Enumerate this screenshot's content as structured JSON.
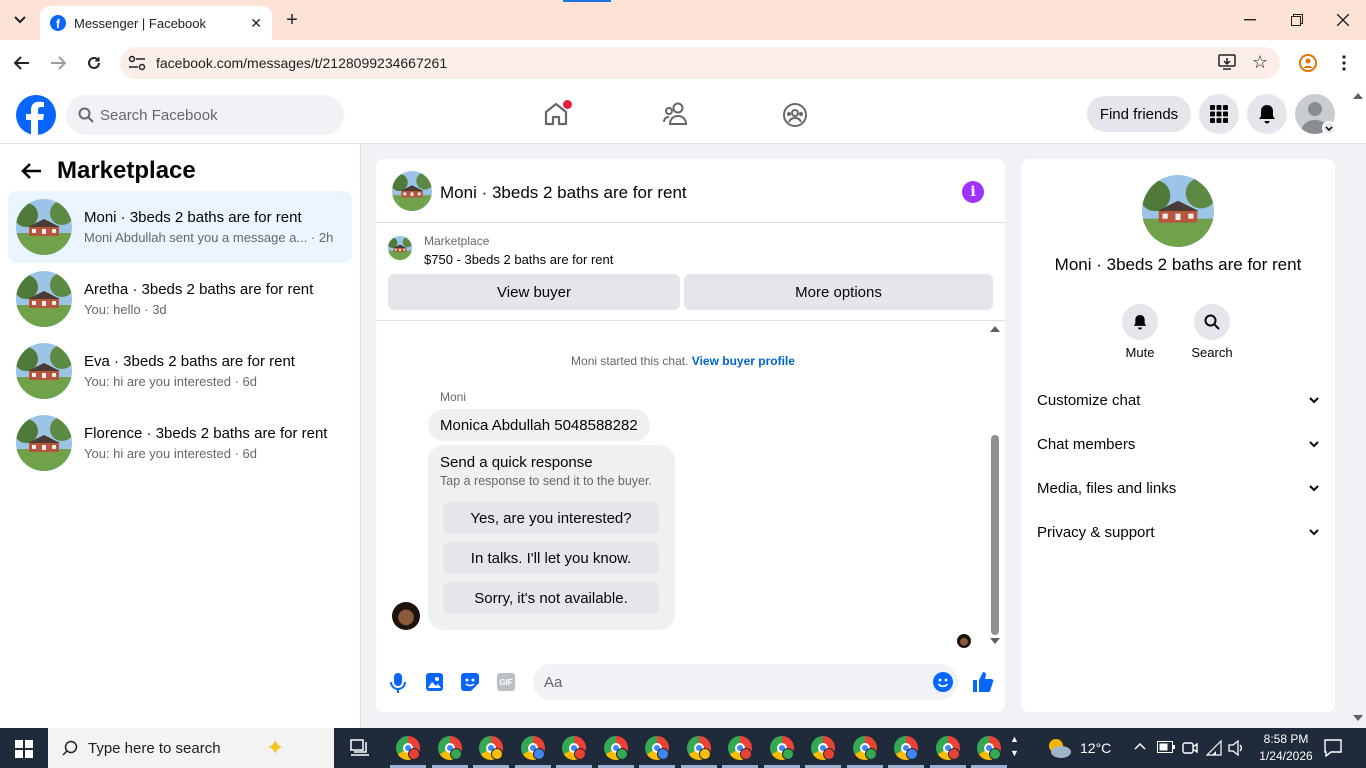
{
  "browser": {
    "tab_title": "Messenger | Facebook",
    "url": "facebook.com/messages/t/2128099234667261"
  },
  "fb_header": {
    "search_placeholder": "Search Facebook",
    "find_friends": "Find friends"
  },
  "sidebar": {
    "title": "Marketplace",
    "conversations": [
      {
        "title": "Moni · 3beds 2 baths are for rent",
        "preview": "Moni Abdullah sent you a message a...",
        "time": "2h"
      },
      {
        "title": "Aretha · 3beds 2 baths are for rent",
        "preview": "You: hello",
        "time": "3d"
      },
      {
        "title": "Eva · 3beds 2 baths are for rent",
        "preview": "You: hi are you interested",
        "time": "6d"
      },
      {
        "title": "Florence · 3beds 2 baths are for rent",
        "preview": "You: hi are you interested",
        "time": "6d"
      }
    ]
  },
  "chat": {
    "title": "Moni · 3beds 2 baths are for rent",
    "listing_source": "Marketplace",
    "listing_text": "$750 - 3beds 2 baths are for rent",
    "view_buyer": "View buyer",
    "more_options": "More options",
    "started_text": "Moni started this chat.",
    "buyer_profile_link": "View buyer profile",
    "sender_name": "Moni",
    "message": "Monica Abdullah 5048588282",
    "quick_title": "Send a quick response",
    "quick_subtitle": "Tap a response to send it to the buyer.",
    "quick_responses": [
      "Yes, are you interested?",
      "In talks. I'll let you know.",
      "Sorry, it's not available."
    ],
    "composer_placeholder": "Aa"
  },
  "details": {
    "title": "Moni · 3beds 2 baths are for rent",
    "mute": "Mute",
    "search": "Search",
    "sections": [
      "Customize chat",
      "Chat members",
      "Media, files and links",
      "Privacy & support"
    ]
  },
  "taskbar": {
    "search_placeholder": "Type here to search",
    "weather": "12°C",
    "time": "8:58 PM",
    "date": "1/24/2026"
  },
  "colors": {
    "fb_blue": "#0866ff",
    "messenger_purple": "#a033ff",
    "selected_row": "#ebf5ff"
  }
}
